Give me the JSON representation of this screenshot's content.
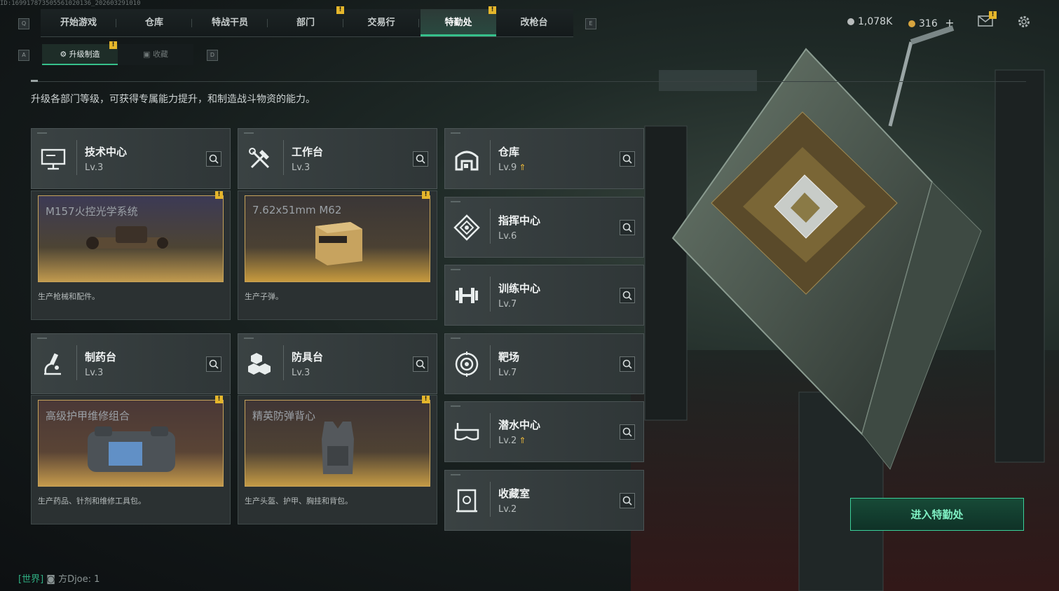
{
  "top_id": "ID:169917873505561020136_202603291010",
  "nav": {
    "key_left": "Q",
    "key_right": "E",
    "tabs": [
      {
        "label": "开始游戏",
        "alert": false
      },
      {
        "label": "仓库",
        "alert": false
      },
      {
        "label": "特战干员",
        "alert": false
      },
      {
        "label": "部门",
        "alert": true
      },
      {
        "label": "交易行",
        "alert": false
      },
      {
        "label": "特勤处",
        "alert": true,
        "active": true
      },
      {
        "label": "改枪台",
        "alert": false
      }
    ]
  },
  "header": {
    "currency1": "1,078K",
    "currency2": "316",
    "plus": "+",
    "mail_alert": true
  },
  "subtabs": {
    "key_left": "A",
    "key_right": "D",
    "active": "升级制造",
    "inactive": "收藏"
  },
  "alert_glyph": "!",
  "description": "升级各部门等级，可获得专属能力提升，和制造战斗物资的能力。",
  "departments_left": [
    {
      "name": "技术中心",
      "level": "Lv.3",
      "icon": "monitor-icon",
      "product_title": "M157火控光学系统",
      "product_desc": "生产枪械和配件。",
      "product_icon": "scope-item"
    },
    {
      "name": "工作台",
      "level": "Lv.3",
      "icon": "tools-icon",
      "product_title": "7.62x51mm M62",
      "product_desc": "生产子弹。",
      "product_icon": "ammo-box-item"
    },
    {
      "name": "制药台",
      "level": "Lv.3",
      "icon": "microscope-icon",
      "product_title": "高级护甲维修组合",
      "product_desc": "生产药品、针剂和维修工具包。",
      "product_icon": "repair-kit-item"
    },
    {
      "name": "防具台",
      "level": "Lv.3",
      "icon": "blocks-icon",
      "product_title": "精英防弹背心",
      "product_desc": "生产头盔、护甲、胸挂和背包。",
      "product_icon": "vest-item"
    }
  ],
  "departments_right": [
    {
      "name": "仓库",
      "level": "Lv.9",
      "upgrade": true,
      "icon": "warehouse-icon"
    },
    {
      "name": "指挥中心",
      "level": "Lv.6",
      "upgrade": false,
      "icon": "command-icon"
    },
    {
      "name": "训练中心",
      "level": "Lv.7",
      "upgrade": false,
      "icon": "dumbbell-icon"
    },
    {
      "name": "靶场",
      "level": "Lv.7",
      "upgrade": false,
      "icon": "target-icon"
    },
    {
      "name": "潜水中心",
      "level": "Lv.2",
      "upgrade": true,
      "icon": "diving-mask-icon"
    },
    {
      "name": "收藏室",
      "level": "Lv.2",
      "upgrade": false,
      "icon": "collection-icon"
    }
  ],
  "enter_button": "进入特勤处",
  "chat": {
    "channel": "[世界]",
    "name": "方Djoe",
    "text": ": 1"
  },
  "colors": {
    "accent": "#36c08b",
    "alert": "#e5b62b",
    "gold": "#c7a35a"
  }
}
